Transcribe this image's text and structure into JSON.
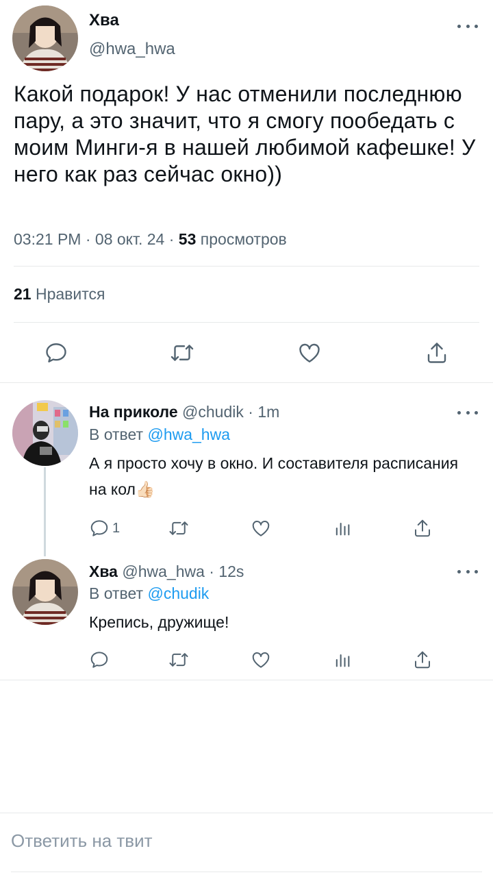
{
  "main_tweet": {
    "name": "Хва",
    "handle": "@hwa_hwa",
    "text": "Какой подарок! У нас отменили последнюю пару, а это значит, что я смогу пообедать с моим Минги-я в нашей любимой кафешке! У него как раз сейчас окно))",
    "time": "03:21 PM",
    "date": "08 окт. 24",
    "views_count": "53",
    "views_label": "просмотров",
    "likes_count": "21",
    "likes_label": "Нравится"
  },
  "replies": [
    {
      "name": "На приколе",
      "handle": "@chudik",
      "time": "1m",
      "reply_to_label": "В ответ",
      "reply_to_handle": "@hwa_hwa",
      "text": "А я просто хочу в окно. И составителя расписания на кол👍🏻",
      "reply_count": "1"
    },
    {
      "name": "Хва",
      "handle": "@hwa_hwa",
      "time": "12s",
      "reply_to_label": "В ответ",
      "reply_to_handle": "@chudik",
      "text": "Крепись, дружище!",
      "reply_count": ""
    }
  ],
  "compose": {
    "placeholder": "Ответить на твит"
  },
  "separators": {
    "dot": "·"
  },
  "icons": [
    "more-icon",
    "reply-icon",
    "retweet-icon",
    "like-icon",
    "share-icon",
    "views-icon"
  ],
  "colors": {
    "text": "#0f1419",
    "secondary": "#536471",
    "link": "#1d9bf0",
    "divider": "#e7e9ea"
  }
}
